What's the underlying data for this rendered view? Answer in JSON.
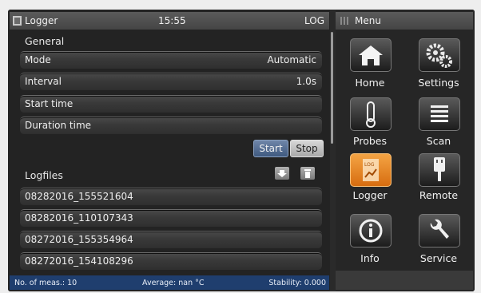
{
  "titlebar": {
    "title": "Logger",
    "time": "15:55",
    "mode": "LOG"
  },
  "general": {
    "heading": "General",
    "rows": [
      {
        "label": "Mode",
        "value": "Automatic"
      },
      {
        "label": "Interval",
        "value": "1.0s"
      },
      {
        "label": "Start time",
        "value": ""
      },
      {
        "label": "Duration time",
        "value": ""
      }
    ],
    "start_label": "Start",
    "stop_label": "Stop"
  },
  "logfiles": {
    "heading": "Logfiles",
    "items": [
      "08282016_155521604",
      "08282016_110107343",
      "08272016_155354964",
      "08272016_154108296"
    ]
  },
  "status": {
    "meas": "No. of meas.: 10",
    "average": "Average: nan °C",
    "stability": "Stability: 0.000"
  },
  "menu": {
    "title": "Menu",
    "items": [
      {
        "label": "Home",
        "icon": "home-icon"
      },
      {
        "label": "Settings",
        "icon": "gears-icon"
      },
      {
        "label": "Probes",
        "icon": "thermometer-icon"
      },
      {
        "label": "Scan",
        "icon": "list-icon"
      },
      {
        "label": "Logger",
        "icon": "logger-icon",
        "active": true
      },
      {
        "label": "Remote",
        "icon": "usb-icon"
      },
      {
        "label": "Info",
        "icon": "info-icon"
      },
      {
        "label": "Service",
        "icon": "wrench-icon"
      }
    ]
  },
  "colors": {
    "accent": "#e8892a",
    "status_bar": "#1f3e6e",
    "start_button": "#52698f"
  }
}
